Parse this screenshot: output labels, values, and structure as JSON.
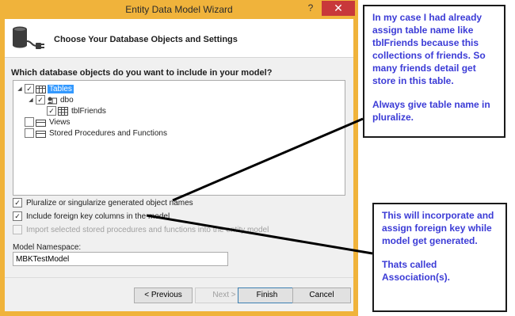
{
  "window": {
    "title": "Entity Data Model Wizard",
    "help_glyph": "?",
    "close_glyph": "✕"
  },
  "header": {
    "title": "Choose Your Database Objects and Settings"
  },
  "main": {
    "question": "Which database objects do you want to include in your model?",
    "tree": [
      {
        "label": "Tables",
        "checked": true,
        "selected": true
      },
      {
        "label": "dbo",
        "checked": true,
        "selected": false
      },
      {
        "label": "tblFriends",
        "checked": true,
        "selected": false
      },
      {
        "label": "Views",
        "checked": false,
        "selected": false
      },
      {
        "label": "Stored Procedures and Functions",
        "checked": false,
        "selected": false
      }
    ],
    "options": [
      {
        "label": "Pluralize or singularize generated object names",
        "checked": true,
        "enabled": true
      },
      {
        "label": "Include foreign key columns in the model",
        "checked": true,
        "enabled": true
      },
      {
        "label": "Import selected stored procedures and functions into the entity model",
        "checked": false,
        "enabled": false
      }
    ],
    "namespace_label": "Model Namespace:",
    "namespace_value": "MBKTestModel"
  },
  "buttons": {
    "previous": "< Previous",
    "next": "Next >",
    "finish": "Finish",
    "cancel": "Cancel"
  },
  "annotations": {
    "note1_p1": "In my case I had already assign table name like tblFriends because this collections of friends. So many friends detail get store in this table.",
    "note1_p2": "Always give table name in pluralize.",
    "note2_p1": "This will incorporate and assign foreign key while model get generated.",
    "note2_p2": "Thats called Association(s)."
  },
  "colors": {
    "title_bar": "#f0b33b",
    "close_button": "#c8383a",
    "selection": "#3399ff",
    "annotation_text": "#3b3bd6"
  }
}
